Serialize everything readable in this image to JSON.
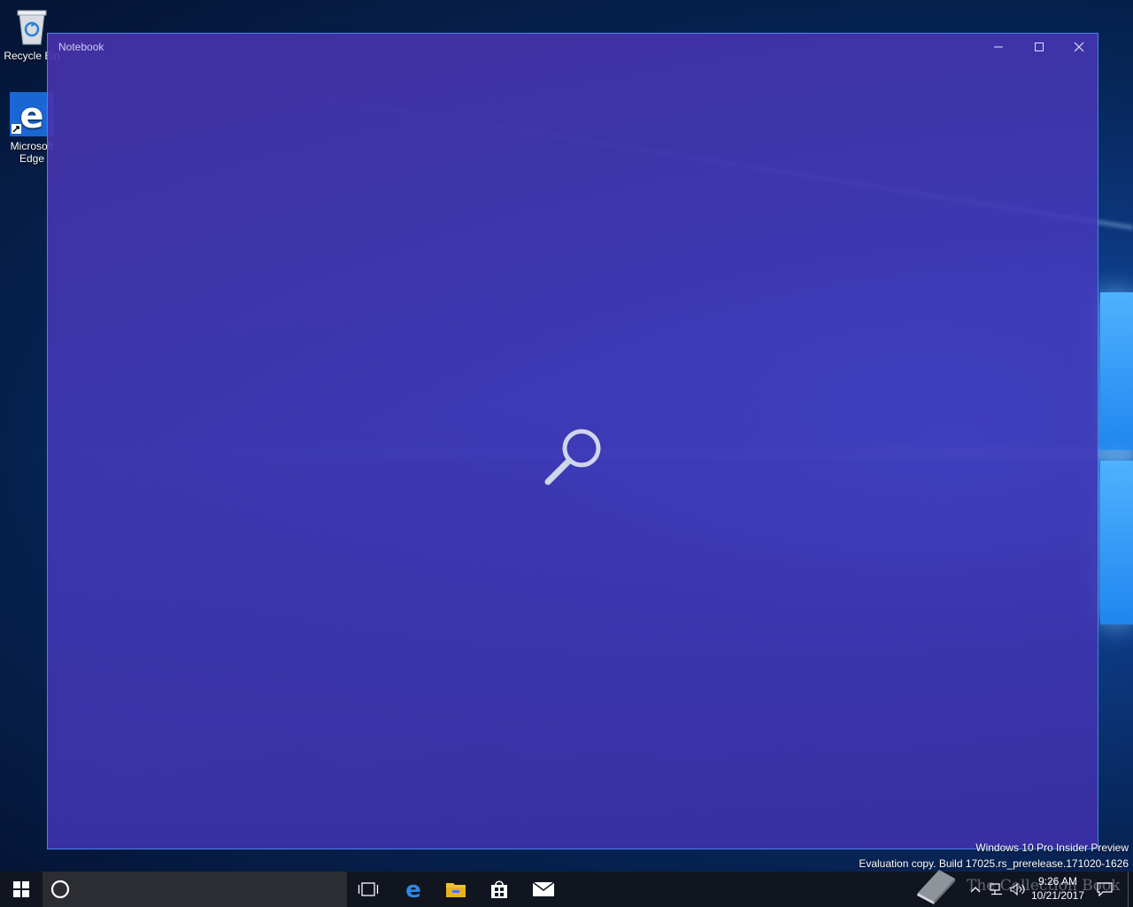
{
  "desktop": {
    "icons": [
      {
        "label": "Recycle Bin",
        "icon": "recycle-bin-icon"
      },
      {
        "label": "Microsoft Edge",
        "icon": "edge-icon"
      }
    ],
    "watermark": {
      "line1": "Windows 10 Pro Insider Preview",
      "line2": "Evaluation copy. Build 17025.rs_prerelease.171020-1626"
    },
    "overlay_text": "The Collection Book"
  },
  "window": {
    "title": "Notebook",
    "minimize_icon": "minimize-icon",
    "maximize_icon": "maximize-icon",
    "close_icon": "close-icon",
    "loading_icon": "search-icon",
    "bg_color": "#4632aa"
  },
  "taskbar": {
    "start_icon": "windows-start-icon",
    "cortana_icon": "cortana-icon",
    "pinned": [
      {
        "icon": "task-view-icon"
      },
      {
        "icon": "edge-icon"
      },
      {
        "icon": "file-explorer-icon"
      },
      {
        "icon": "store-icon"
      },
      {
        "icon": "mail-icon"
      }
    ],
    "clock": {
      "time": "9:26 AM",
      "date": "10/21/2017"
    }
  }
}
